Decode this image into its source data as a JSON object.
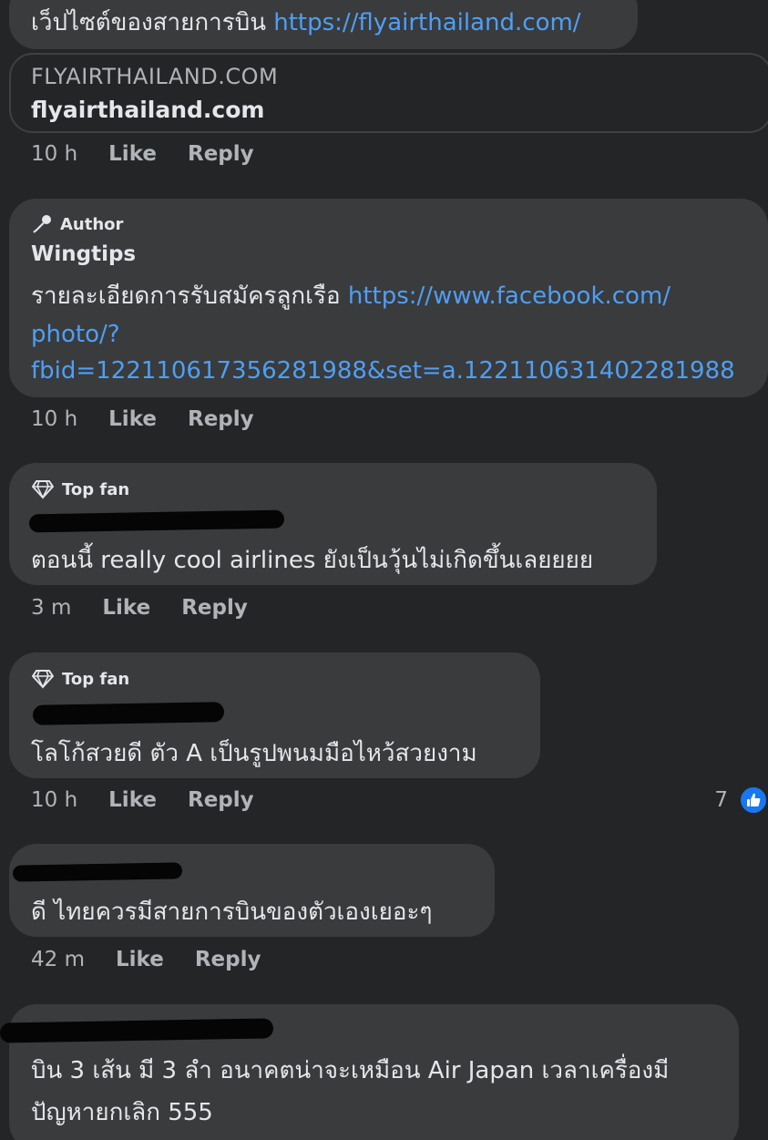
{
  "colors": {
    "background": "#242526",
    "bubble": "#3a3b3c",
    "link": "#4e9ff5",
    "muted": "#b0b3b8",
    "like_blue": "#1877f2"
  },
  "comments": [
    {
      "text": "เว็ปไซต์ของสายการบิน",
      "link": "https://flyairthailand.com/",
      "preview": {
        "domain": "FLYAIRTHAILAND.COM",
        "title": "flyairthailand.com"
      },
      "time": "10 h",
      "like": "Like",
      "reply": "Reply"
    },
    {
      "badge": "Author",
      "badge_icon": "microphone-icon",
      "name": "Wingtips",
      "text": "รายละเอียดการรับสมัครลูกเรือ",
      "link_line1": "https://www.facebook.com/",
      "link_line2": "photo/?",
      "link_line3": "fbid=122110617356281988&set=a.122110631402281988",
      "time": "10 h",
      "like": "Like",
      "reply": "Reply"
    },
    {
      "badge": "Top fan",
      "badge_icon": "diamond-icon",
      "text": "ตอนนี้ really cool airlines ยังเป็นวุ้นไม่เกิดขึ้นเลยยยย",
      "time": "3 m",
      "like": "Like",
      "reply": "Reply"
    },
    {
      "badge": "Top fan",
      "badge_icon": "diamond-icon",
      "text": "โลโก้สวยดี ตัว A เป็นรูปพนมมือไหว้สวยงาม",
      "time": "10 h",
      "like": "Like",
      "reply": "Reply",
      "reaction_count": "7",
      "reaction_icon": "thumbs-up-icon"
    },
    {
      "text": "ดี ไทยควรมีสายการบินของตัวเองเยอะๆ",
      "time": "42 m",
      "like": "Like",
      "reply": "Reply"
    },
    {
      "text_line1": "บิน 3 เส้น มี 3 ลำ อนาคตน่าจะเหมือน Air Japan เวลาเครื่องมี",
      "text_line2": "ปัญหายกเลิก 555"
    }
  ]
}
